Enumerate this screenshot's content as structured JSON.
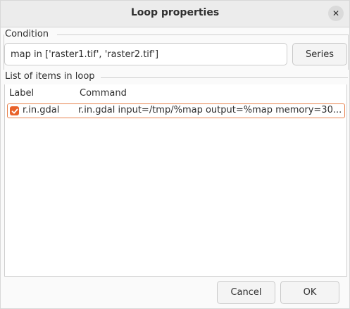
{
  "window": {
    "title": "Loop properties"
  },
  "condition": {
    "group_label": "Condition",
    "value": "map in ['raster1.tif', 'raster2.tif']",
    "series_button": "Series"
  },
  "items": {
    "group_label": "List of items in loop",
    "columns": [
      "Label",
      "Command"
    ],
    "rows": [
      {
        "checked": true,
        "label": "r.in.gdal",
        "command": "r.in.gdal input=/tmp/%map output=%map memory=30..."
      }
    ]
  },
  "buttons": {
    "cancel": "Cancel",
    "ok": "OK"
  },
  "colors": {
    "accent": "#e9622a",
    "selection_border": "#e8834f"
  },
  "icons": [
    "close-icon",
    "check-icon"
  ]
}
